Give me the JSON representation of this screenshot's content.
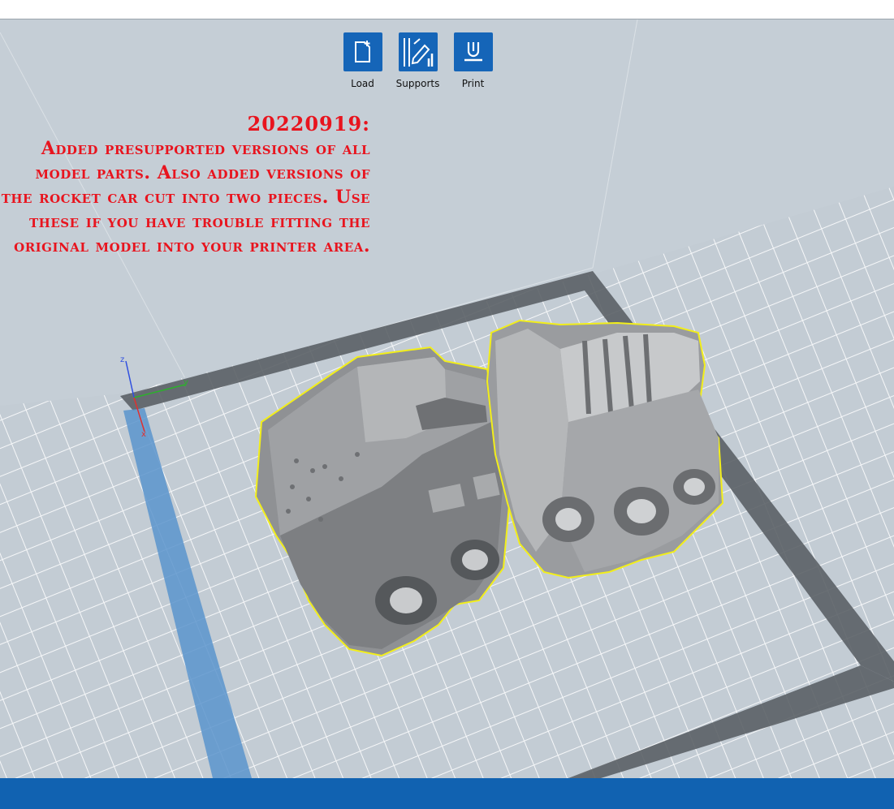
{
  "toolbar": {
    "load_label": "Load",
    "supports_label": "Supports",
    "print_label": "Print"
  },
  "note": {
    "date": "20220919:",
    "text": "Added presupported versions of all model parts. Also added versions of the rocket car cut into two pieces. Use these if you have trouble fitting the original model into your printer area."
  },
  "axes": {
    "z": "z",
    "y": "y",
    "x": "x"
  },
  "icons": {
    "load": "add-file-icon",
    "supports": "supports-icon",
    "print": "print-icon"
  },
  "colors": {
    "accent": "#1565b8",
    "note_text": "#e8141e",
    "selection_outline": "#f2ee1a",
    "bottom_bar": "#1162b1"
  }
}
